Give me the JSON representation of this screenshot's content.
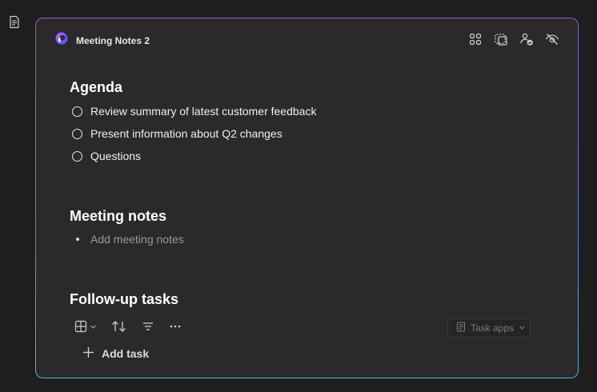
{
  "window": {
    "title": "Meeting Notes 2"
  },
  "sections": {
    "agenda": {
      "heading": "Agenda",
      "items": [
        {
          "label": "Review summary of latest customer feedback"
        },
        {
          "label": "Present information about Q2 changes"
        },
        {
          "label": "Questions"
        }
      ]
    },
    "meeting_notes": {
      "heading": "Meeting notes",
      "placeholder": "Add meeting notes"
    },
    "follow_up": {
      "heading": "Follow-up tasks",
      "task_apps_label": "Task apps",
      "add_task_label": "Add task"
    }
  },
  "icons": {
    "sidebar": "document-icon",
    "logo": "loop-logo-icon",
    "toolbar": [
      "components-icon",
      "select-area-icon",
      "people-check-icon",
      "hide-icon"
    ],
    "task_toolbar": [
      "table-view-icon",
      "sort-icon",
      "filter-icon",
      "more-icon"
    ]
  },
  "colors": {
    "background": "#1f1e1f",
    "card": "#2b292b",
    "border_gradient_top": "#8b5fd8",
    "border_gradient_bottom": "#4fb3d6",
    "placeholder_text": "#9a9a9a"
  }
}
